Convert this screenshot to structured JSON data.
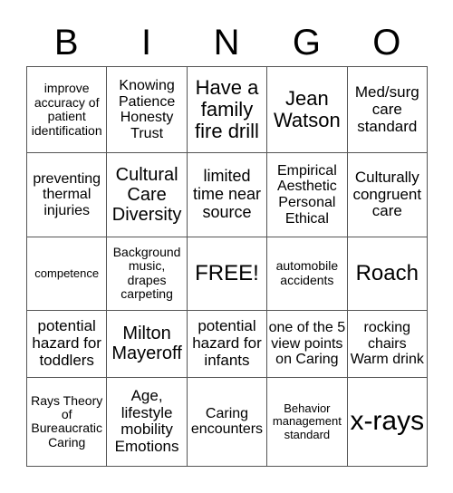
{
  "header": {
    "letters": [
      "B",
      "I",
      "N",
      "G",
      "O"
    ]
  },
  "grid": [
    [
      "improve accuracy of patient identification",
      "Knowing Patience Honesty Trust",
      "Have a family fire drill",
      "Jean Watson",
      "Med/surg care standard"
    ],
    [
      "preventing thermal injuries",
      "Cultural Care Diversity",
      "limited time near source",
      "Empirical Aesthetic Personal Ethical",
      "Culturally congruent care"
    ],
    [
      "competence",
      "Background music, drapes carpeting",
      "FREE!",
      "automobile accidents",
      "Roach"
    ],
    [
      "potential hazard for toddlers",
      "Milton Mayeroff",
      "potential hazard for infants",
      "one of the 5 view points on Caring",
      "rocking chairs Warm drink"
    ],
    [
      "Rays Theory of Bureaucratic Caring",
      "Age, lifestyle mobility Emotions",
      "Caring encounters",
      "Behavior management standard",
      "x-rays"
    ]
  ]
}
